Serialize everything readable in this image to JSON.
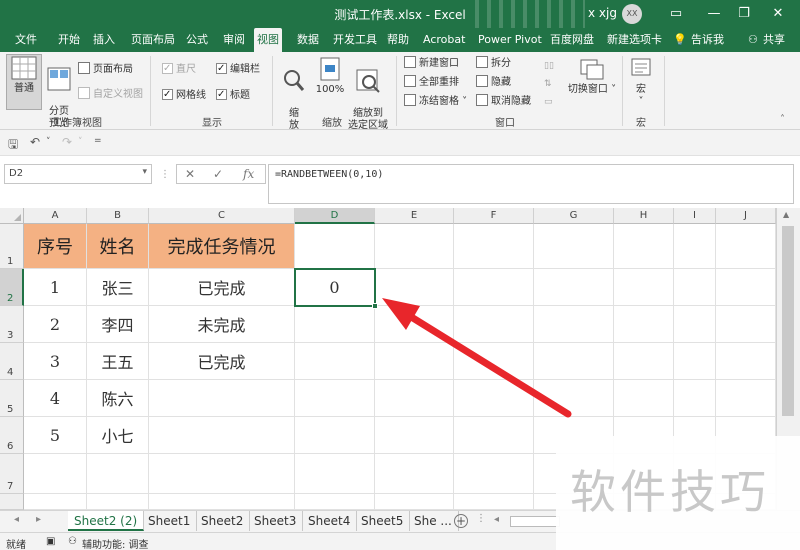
{
  "window": {
    "title": "测试工作表.xlsx  -  Excel",
    "user_name": "x xjg",
    "avatar_initials": "XX",
    "minimize": "—",
    "restore": "❐",
    "close": "✕"
  },
  "menu": {
    "tabs": [
      "文件",
      "开始",
      "插入",
      "页面布局",
      "公式",
      "审阅",
      "视图",
      "数据",
      "开发工具",
      "帮助",
      "Acrobat",
      "Power Pivot",
      "百度网盘",
      "新建选项卡"
    ],
    "active_tab": "视图",
    "tell_me": "告诉我",
    "share": "共享"
  },
  "ribbon": {
    "workbook_views": {
      "normal": "普通",
      "page_break": "分页\n预览",
      "page_layout": "页面布局",
      "custom_views": "自定义视图",
      "label": "工作簿视图"
    },
    "show": {
      "ruler": "直尺",
      "edit_bar": "编辑栏",
      "gridlines": "网格线",
      "headings": "标题",
      "label": "显示"
    },
    "zoom": {
      "zoom": "缩\n放",
      "percent": "100%",
      "zoom_to_selection": "缩放到\n选定区域",
      "label": "缩放"
    },
    "window": {
      "new_window": "新建窗口",
      "arrange_all": "全部重排",
      "freeze_panes": "冻结窗格",
      "split": "拆分",
      "hide": "隐藏",
      "unhide": "取消隐藏",
      "switch_windows": "切换窗口",
      "label": "窗口"
    },
    "macros": {
      "macros": "宏",
      "label": "宏"
    }
  },
  "formula_bar": {
    "name_box": "D2",
    "formula": "=RANDBETWEEN(0,10)"
  },
  "grid": {
    "columns": [
      "A",
      "B",
      "C",
      "D",
      "E",
      "F",
      "G",
      "H",
      "I",
      "J"
    ],
    "rows": [
      "1",
      "2",
      "3",
      "4",
      "5",
      "6",
      "7"
    ],
    "selected_column": "D",
    "selected_row": "2",
    "header_row": [
      "序号",
      "姓名",
      "完成任务情况"
    ],
    "data_rows": [
      {
        "no": "1",
        "name": "张三",
        "status": "已完成"
      },
      {
        "no": "2",
        "name": "李四",
        "status": "未完成"
      },
      {
        "no": "3",
        "name": "王五",
        "status": "已完成"
      },
      {
        "no": "4",
        "name": "陈六",
        "status": ""
      },
      {
        "no": "5",
        "name": "小七",
        "status": ""
      }
    ],
    "active_cell_value": "0",
    "header_fill_color": "#f4b183",
    "accent_color": "#217346"
  },
  "sheets": {
    "tabs": [
      "Sheet2 (2)",
      "Sheet1",
      "Sheet2",
      "Sheet3",
      "Sheet4",
      "Sheet5",
      "She ..."
    ],
    "active": "Sheet2 (2)"
  },
  "status_bar": {
    "ready": "就绪",
    "accessibility": "辅助功能: 调查"
  },
  "watermark": "软件技巧",
  "annotation_arrow_color": "#e8262b"
}
